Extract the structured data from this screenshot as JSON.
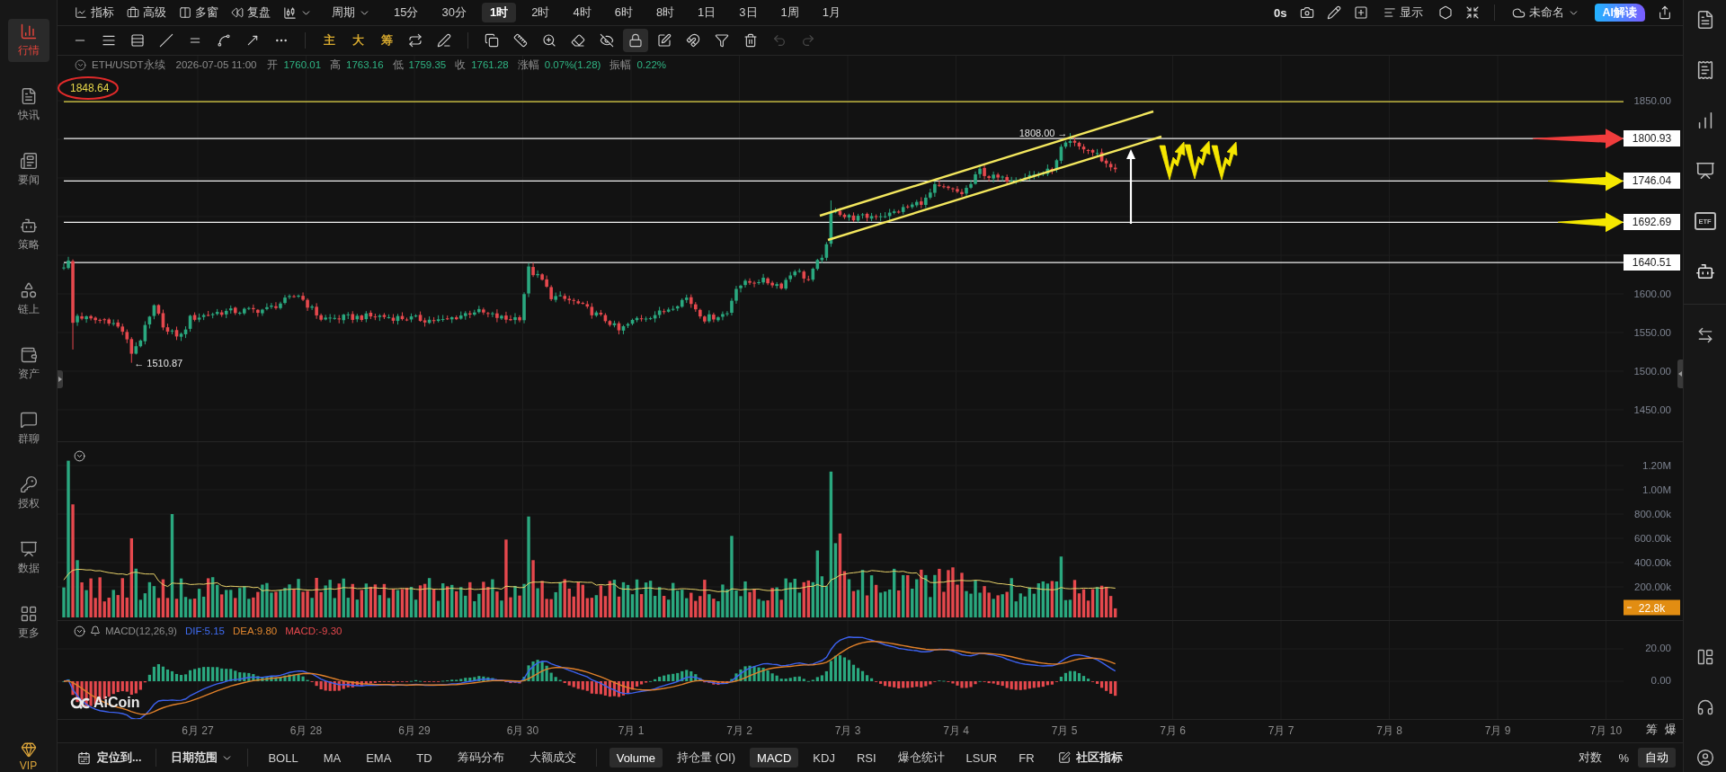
{
  "sidebar": {
    "items": [
      {
        "label": "行情",
        "selected": true
      },
      {
        "label": "快讯",
        "selected": false
      },
      {
        "label": "要闻",
        "selected": false
      },
      {
        "label": "策略",
        "selected": false
      },
      {
        "label": "链上",
        "selected": false
      },
      {
        "label": "资产",
        "selected": false
      },
      {
        "label": "群聊",
        "selected": false
      },
      {
        "label": "授权",
        "selected": false
      },
      {
        "label": "数据",
        "selected": false
      },
      {
        "label": "更多",
        "selected": false
      }
    ],
    "vip": "VIP"
  },
  "top_bar": {
    "tools": [
      "指标",
      "高级",
      "多窗",
      "复盘"
    ],
    "period": "周期",
    "intervals": [
      {
        "label": "15分",
        "selected": false
      },
      {
        "label": "30分",
        "selected": false
      },
      {
        "label": "1时",
        "selected": true
      },
      {
        "label": "2时",
        "selected": false
      },
      {
        "label": "4时",
        "selected": false
      },
      {
        "label": "6时",
        "selected": false
      },
      {
        "label": "8时",
        "selected": false
      },
      {
        "label": "1日",
        "selected": false
      },
      {
        "label": "3日",
        "selected": false
      },
      {
        "label": "1周",
        "selected": false
      },
      {
        "label": "1月",
        "selected": false
      }
    ],
    "timer": "0s",
    "display": "显示",
    "layout_name": "未命名",
    "ai_button": "AI解读"
  },
  "drawing_toolbar": {
    "marker_tools": [
      "主",
      "大",
      "筹"
    ],
    "lock": {
      "selected": true
    },
    "undo": {
      "disabled": true
    },
    "redo": {
      "disabled": true
    }
  },
  "chart": {
    "symbol": "ETH/USDT永续",
    "time": "2026-07-05 11:00",
    "quote": [
      {
        "label": "开",
        "value": "1760.01"
      },
      {
        "label": "高",
        "value": "1763.16"
      },
      {
        "label": "低",
        "value": "1759.35"
      },
      {
        "label": "收",
        "value": "1761.28"
      },
      {
        "label": "涨幅",
        "value": "0.07%(1.28)"
      },
      {
        "label": "振幅",
        "value": "0.22%"
      }
    ],
    "note": "1848.64",
    "price_ticks": [
      "1850.00",
      "1600.00",
      "1550.00",
      "1500.00",
      "1450.00"
    ],
    "levels": [
      "1800.93",
      "1746.04",
      "1692.69",
      "1640.51"
    ],
    "high_marker": "1808.00 →",
    "low_marker": "← 1510.87"
  },
  "volume": {
    "ticks": [
      "1.20M",
      "1.00M",
      "800.00k",
      "600.00k",
      "400.00k",
      "200.00k"
    ],
    "last": "22.8k"
  },
  "macd": {
    "title": "MACD(12,26,9)",
    "dif": "DIF:5.15",
    "dea": "DEA:9.80",
    "value": "MACD:-9.30",
    "ticks": [
      "20.00",
      "0.00"
    ]
  },
  "logo": "AiCoin",
  "time_axis": {
    "dates": [
      "6月 27",
      "6月 28",
      "6月 29",
      "6月 30",
      "7月 1",
      "7月 2",
      "7月 3",
      "7月 4",
      "7月 5",
      "7月 6",
      "7月 7",
      "7月 8",
      "7月 9",
      "7月 10"
    ],
    "toggles": [
      "筹",
      "爆"
    ]
  },
  "bottom_bar": {
    "locate": "定位到...",
    "date_range": "日期范围",
    "main_indicators": [
      "BOLL",
      "MA",
      "EMA",
      "TD",
      "筹码分布",
      "大额成交"
    ],
    "sub_indicators": [
      {
        "label": "Volume",
        "selected": true
      },
      {
        "label": "持仓量 (OI)",
        "selected": false
      },
      {
        "label": "MACD",
        "selected": true
      },
      {
        "label": "KDJ",
        "selected": false
      },
      {
        "label": "RSI",
        "selected": false
      },
      {
        "label": "爆仓统计",
        "selected": false
      },
      {
        "label": "LSUR",
        "selected": false
      },
      {
        "label": "FR",
        "selected": false
      }
    ],
    "community": "社区指标",
    "scale_modes": [
      {
        "label": "对数",
        "selected": false
      },
      {
        "label": "%",
        "selected": false
      },
      {
        "label": "自动",
        "selected": true
      }
    ]
  },
  "right_sidebar": {
    "etf_label": "ETF"
  }
}
